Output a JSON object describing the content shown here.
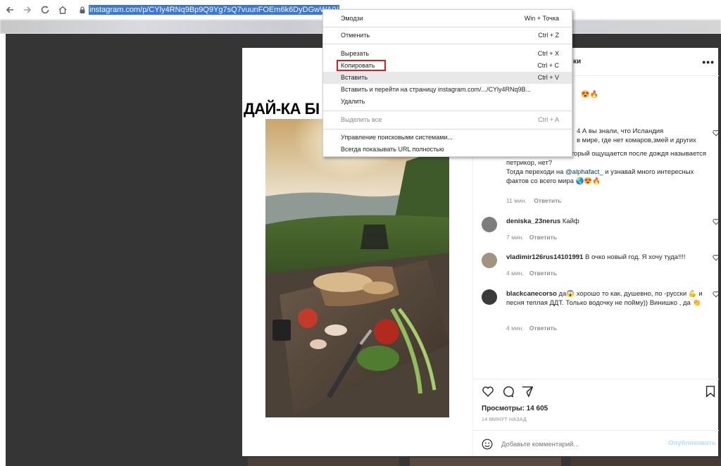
{
  "browser": {
    "url": "instagram.com/p/CYly4RNq9Bp9Q9Yg7sQ7vuunFOEm6k6DyDGwWA0/"
  },
  "post": {
    "headline": "ДАЙ-КА БІ",
    "header_suffix": "ки",
    "header_emojis": "😍🔥",
    "caption_fragment_1": "4 А вы знали, что Исландия",
    "caption_fragment_2": "в мире, где нет комаров,змей и других",
    "caption_full": "Или то, что запах, который ощущается после дождя называется петрикор, нет?",
    "caption_line_cta": "Тогда переходи на ",
    "caption_link": "@alphafact_",
    "caption_line_cta_end": " и узнавай много интересных фактов со всего мира ",
    "caption_emojis": "🌏😍🔥",
    "caption_time": "11 мин.",
    "reply_label": "Ответить"
  },
  "comments": [
    {
      "user": "deniska_23nerus",
      "text": "Кайф",
      "time": "7 мин.",
      "reply": "Ответить"
    },
    {
      "user": "vladimir126rus14101991",
      "text": "В очко новый год. Я хочу туда!!!!",
      "time": "4 мин.",
      "reply": "Ответить"
    },
    {
      "user": "blackcanecorso",
      "text": "да😱 хорошо то как, душевно, по -русски 💪 и песня теплая ДДТ. Только водочку не пойму)) Винишко , да 👏",
      "time": "4 мин.",
      "reply": "Ответить"
    }
  ],
  "actions": {
    "views": "Просмотры: 14 605",
    "posted": "14 МИНУТ НАЗАД",
    "comment_placeholder": "Добавьте комментарий...",
    "publish_label": "Опубликовать"
  },
  "context_menu": {
    "items": [
      {
        "label": "Эмодзи",
        "shortcut": "Win + Точка"
      },
      {
        "label": "Отменить",
        "shortcut": "Ctrl + Z"
      },
      {
        "label": "Вырезать",
        "shortcut": "Ctrl + X"
      },
      {
        "label": "Копировать",
        "shortcut": "Ctrl + C"
      },
      {
        "label": "Вставить",
        "shortcut": "Ctrl + V"
      },
      {
        "label": "Вставить и перейти на страницу instagram.com/.../CYly4RNq9B...",
        "shortcut": ""
      },
      {
        "label": "Удалить",
        "shortcut": ""
      },
      {
        "label": "Выделить все",
        "shortcut": "Ctrl + A"
      },
      {
        "label": "Управление поисковыми системами...",
        "shortcut": ""
      },
      {
        "label": "Всегда показывать URL полностью",
        "shortcut": ""
      }
    ]
  },
  "colors": {
    "highlight_box": "#e11b1b",
    "url_selection": "#3b77d8",
    "backdrop": "#353535",
    "link": "#00376b"
  }
}
